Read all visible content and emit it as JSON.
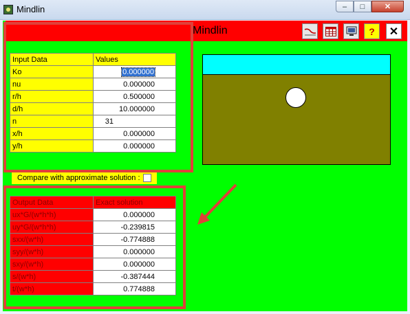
{
  "window": {
    "title": "Mindlin"
  },
  "app": {
    "title": "Mindlin"
  },
  "toolbar": {
    "buttons": [
      {
        "icon": "curve-chart-icon",
        "glyph": "〜"
      },
      {
        "icon": "table-icon",
        "glyph": "▦"
      },
      {
        "icon": "monitor-icon",
        "glyph": "▣"
      },
      {
        "icon": "help-icon",
        "glyph": "?"
      },
      {
        "icon": "exit-icon",
        "glyph": "✕"
      }
    ]
  },
  "input_table": {
    "header": [
      "Input Data",
      "Values"
    ],
    "rows": [
      {
        "label": "Ko",
        "value": "0.000000"
      },
      {
        "label": "nu",
        "value": "0.000000"
      },
      {
        "label": "r/h",
        "value": "0.500000"
      },
      {
        "label": "d/h",
        "value": "10.000000"
      },
      {
        "label": "n",
        "value": "31"
      },
      {
        "label": "x/h",
        "value": "0.000000"
      },
      {
        "label": "y/h",
        "value": "0.000000"
      }
    ]
  },
  "compare": {
    "label": "Compare with approximate solution :",
    "checked": false
  },
  "output_table": {
    "header": [
      "Output Data",
      "Exact solution"
    ],
    "rows": [
      {
        "label": "ux*G/(w*h*h)",
        "value": "0.000000"
      },
      {
        "label": "uy*G/(w*h*h)",
        "value": "-0.239815"
      },
      {
        "label": "sxx/(w*h)",
        "value": "-0.774888"
      },
      {
        "label": "syy/(w*h)",
        "value": "0.000000"
      },
      {
        "label": "sxy/(w*h)",
        "value": "0.000000"
      },
      {
        "label": "s/(w*h)",
        "value": "-0.387444"
      },
      {
        "label": "t/(w*h)",
        "value": "0.774888"
      }
    ]
  },
  "colors": {
    "background": "#00ff00",
    "header_bar": "#ff0000",
    "input_labels": "#ffff00",
    "output_labels": "#ff0000",
    "annotation": "#e0403a",
    "diagram_water": "#00ffff",
    "diagram_soil": "#808000"
  }
}
